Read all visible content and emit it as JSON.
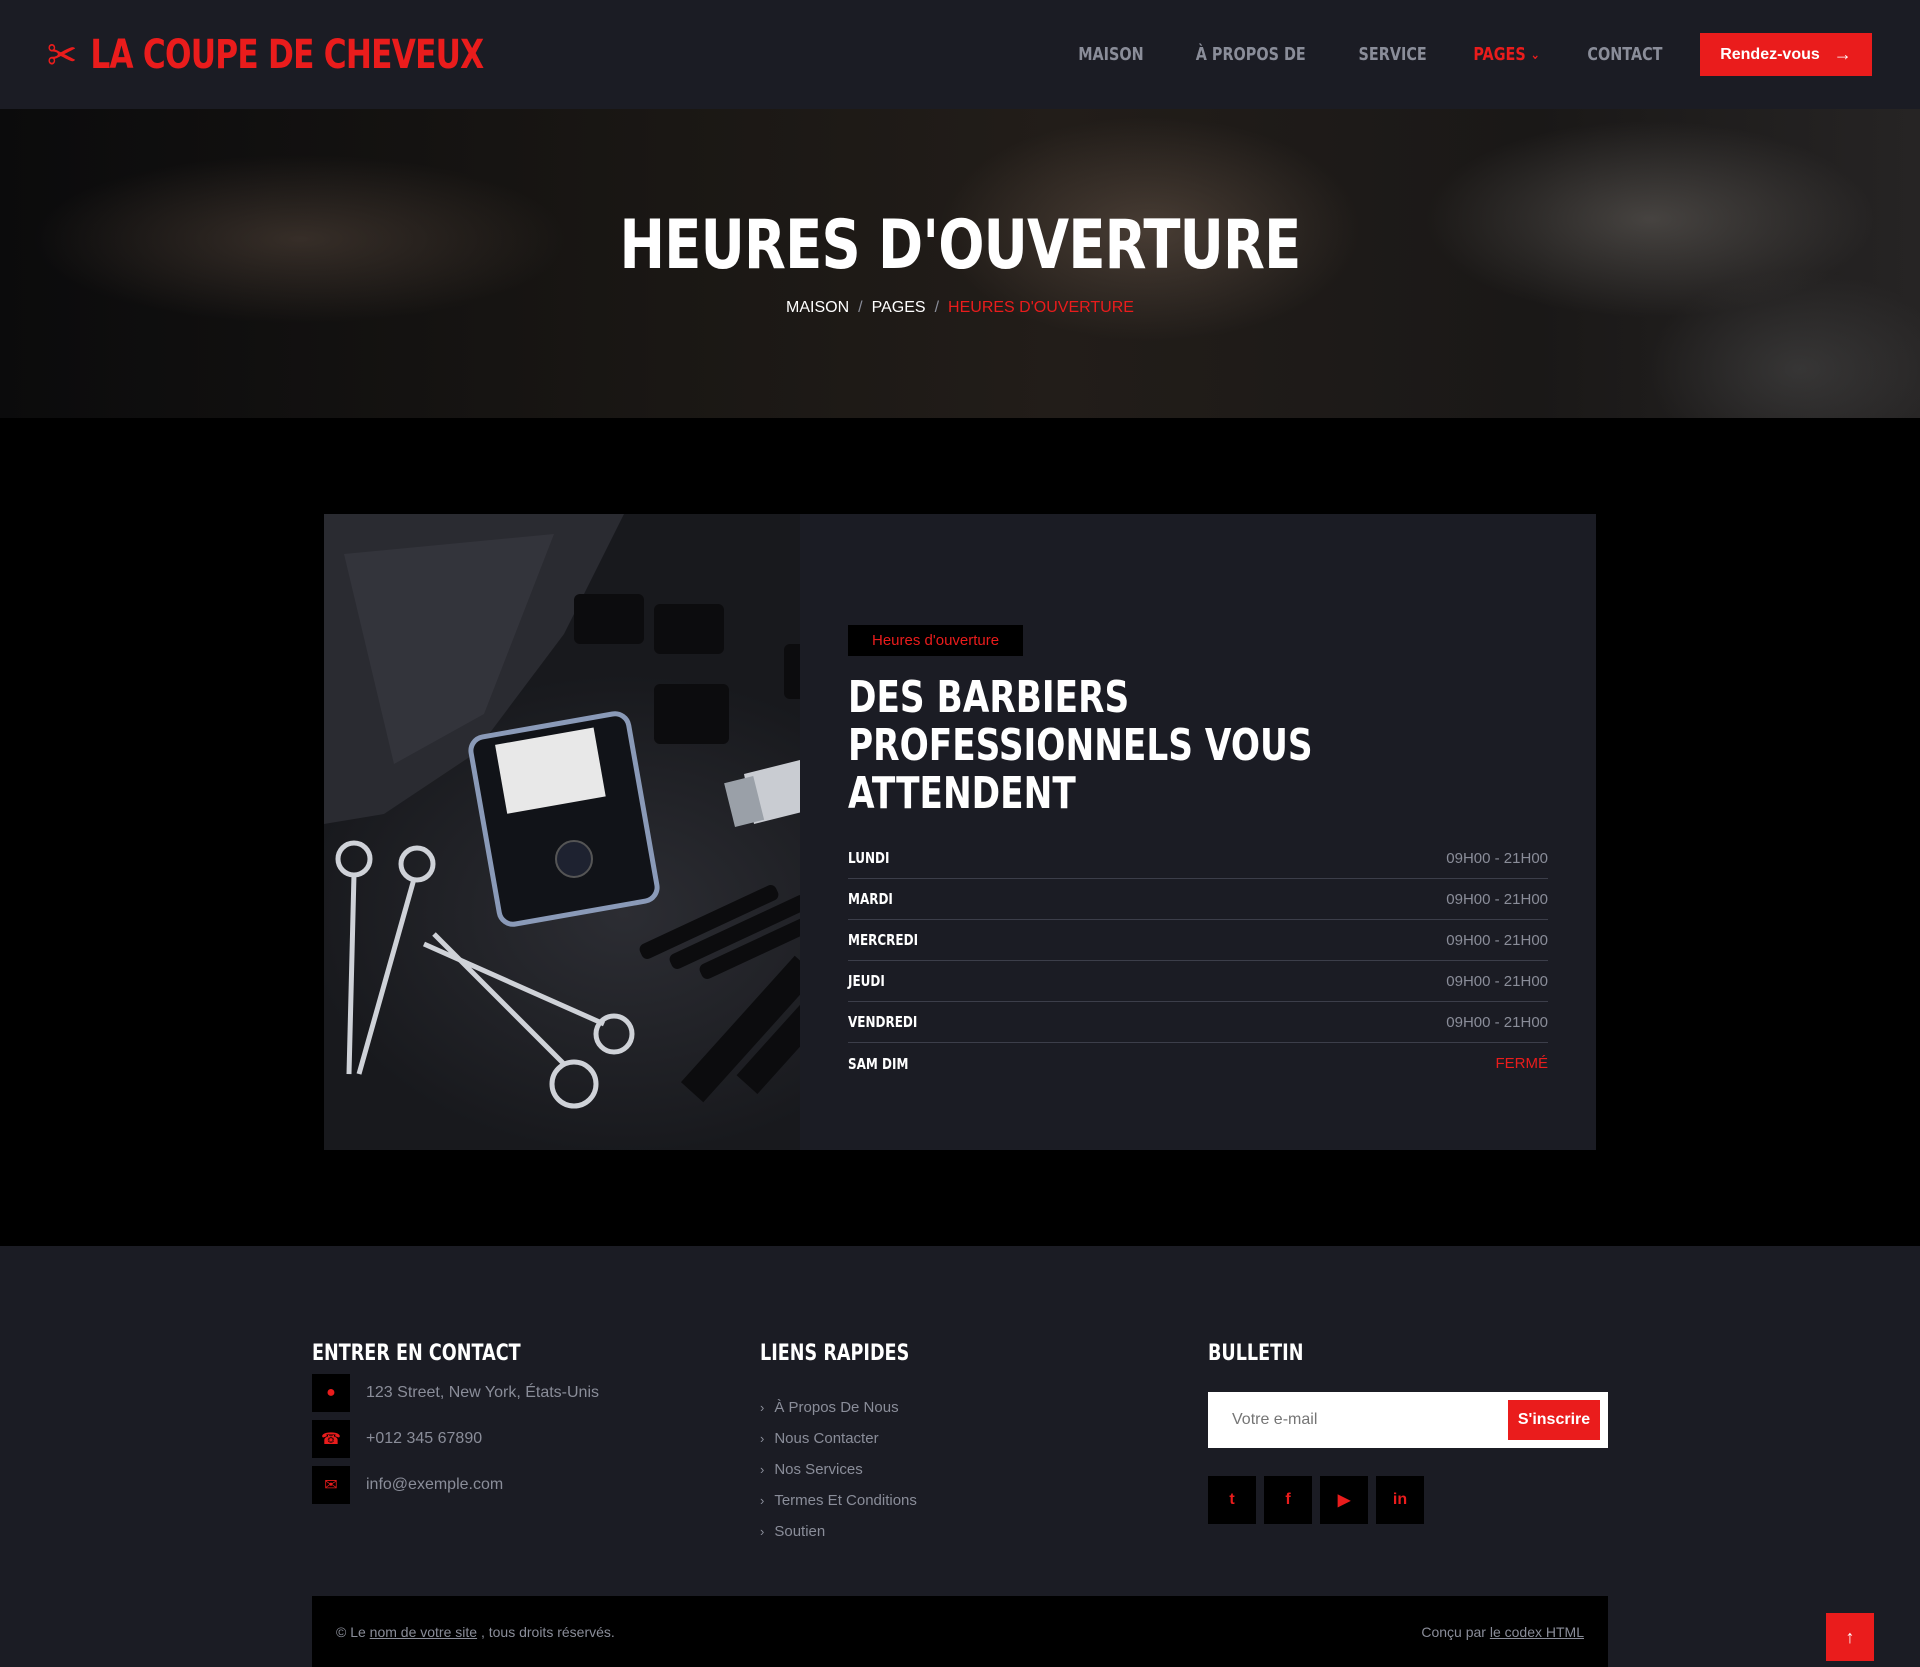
{
  "brand": {
    "name": "LA COUPE DE CHEVEUX",
    "icon": "scissors-icon"
  },
  "nav": {
    "items": [
      {
        "label": "MAISON"
      },
      {
        "label": "À PROPOS DE"
      },
      {
        "label": "SERVICE"
      },
      {
        "label": "PAGES"
      },
      {
        "label": "CONTACT"
      }
    ],
    "cta": "Rendez-vous"
  },
  "hero": {
    "title": "HEURES D'OUVERTURE",
    "breadcrumb": [
      "MAISON",
      "PAGES",
      "HEURES D'OUVERTURE"
    ]
  },
  "hours_section": {
    "tag": "Heures d'ouverture",
    "title": "DES BARBIERS PROFESSIONNELS VOUS ATTENDENT",
    "rows": [
      {
        "day": "LUNDI",
        "time": "09H00 - 21H00"
      },
      {
        "day": "MARDI",
        "time": "09H00 - 21H00"
      },
      {
        "day": "MERCREDI",
        "time": "09H00 - 21H00"
      },
      {
        "day": "JEUDI",
        "time": "09H00 - 21H00"
      },
      {
        "day": "VENDREDI",
        "time": "09H00 - 21H00"
      },
      {
        "day": "SAM DIM",
        "time": "FERMÉ"
      }
    ]
  },
  "footer": {
    "contact": {
      "title": "ENTRER EN CONTACT",
      "address": "123 Street, New York, États-Unis",
      "phone": "+012 345 67890",
      "email": "info@exemple.com"
    },
    "links": {
      "title": "LIENS RAPIDES",
      "items": [
        "À Propos De Nous",
        "Nous Contacter",
        "Nos Services",
        "Termes Et Conditions",
        "Soutien"
      ]
    },
    "newsletter": {
      "title": "BULLETIN",
      "placeholder": "Votre e-mail",
      "button": "S'inscrire"
    },
    "socials": [
      "twitter-icon",
      "facebook-icon",
      "youtube-icon",
      "linkedin-icon"
    ],
    "copyright": {
      "prefix": "© Le",
      "site_link": "nom de votre site",
      "suffix": ", tous droits réservés.",
      "designed_prefix": "Conçu par",
      "designer_link": "le codex HTML"
    }
  },
  "colors": {
    "accent": "#ea1c1c",
    "panel": "#1b1c24",
    "muted": "#8a8d99"
  }
}
